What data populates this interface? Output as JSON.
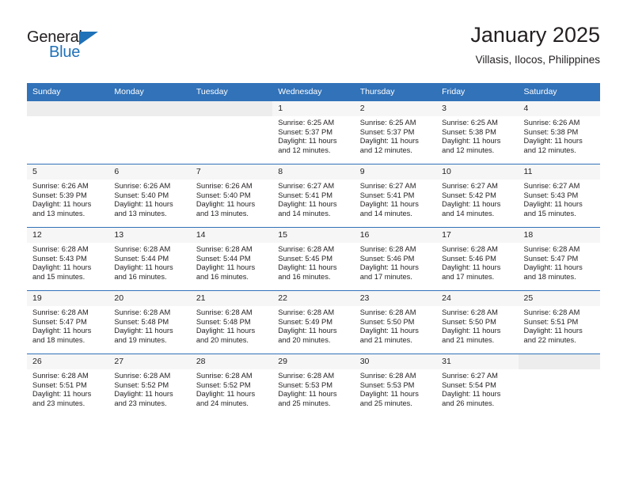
{
  "brand": {
    "name_dark": "General",
    "name_blue": "Blue",
    "accent_color": "#1f71b8"
  },
  "header": {
    "title": "January 2025",
    "subtitle": "Villasis, Ilocos, Philippines",
    "header_bg": "#3172b9"
  },
  "weekdays": [
    "Sunday",
    "Monday",
    "Tuesday",
    "Wednesday",
    "Thursday",
    "Friday",
    "Saturday"
  ],
  "labels": {
    "sunrise": "Sunrise:",
    "sunset": "Sunset:",
    "daylight": "Daylight:"
  },
  "weeks": [
    [
      {
        "day": "",
        "empty": true
      },
      {
        "day": "",
        "empty": true
      },
      {
        "day": "",
        "empty": true
      },
      {
        "day": "1",
        "sunrise": "Sunrise: 6:25 AM",
        "sunset": "Sunset: 5:37 PM",
        "daylight1": "Daylight: 11 hours",
        "daylight2": "and 12 minutes."
      },
      {
        "day": "2",
        "sunrise": "Sunrise: 6:25 AM",
        "sunset": "Sunset: 5:37 PM",
        "daylight1": "Daylight: 11 hours",
        "daylight2": "and 12 minutes."
      },
      {
        "day": "3",
        "sunrise": "Sunrise: 6:25 AM",
        "sunset": "Sunset: 5:38 PM",
        "daylight1": "Daylight: 11 hours",
        "daylight2": "and 12 minutes."
      },
      {
        "day": "4",
        "sunrise": "Sunrise: 6:26 AM",
        "sunset": "Sunset: 5:38 PM",
        "daylight1": "Daylight: 11 hours",
        "daylight2": "and 12 minutes."
      }
    ],
    [
      {
        "day": "5",
        "sunrise": "Sunrise: 6:26 AM",
        "sunset": "Sunset: 5:39 PM",
        "daylight1": "Daylight: 11 hours",
        "daylight2": "and 13 minutes."
      },
      {
        "day": "6",
        "sunrise": "Sunrise: 6:26 AM",
        "sunset": "Sunset: 5:40 PM",
        "daylight1": "Daylight: 11 hours",
        "daylight2": "and 13 minutes."
      },
      {
        "day": "7",
        "sunrise": "Sunrise: 6:26 AM",
        "sunset": "Sunset: 5:40 PM",
        "daylight1": "Daylight: 11 hours",
        "daylight2": "and 13 minutes."
      },
      {
        "day": "8",
        "sunrise": "Sunrise: 6:27 AM",
        "sunset": "Sunset: 5:41 PM",
        "daylight1": "Daylight: 11 hours",
        "daylight2": "and 14 minutes."
      },
      {
        "day": "9",
        "sunrise": "Sunrise: 6:27 AM",
        "sunset": "Sunset: 5:41 PM",
        "daylight1": "Daylight: 11 hours",
        "daylight2": "and 14 minutes."
      },
      {
        "day": "10",
        "sunrise": "Sunrise: 6:27 AM",
        "sunset": "Sunset: 5:42 PM",
        "daylight1": "Daylight: 11 hours",
        "daylight2": "and 14 minutes."
      },
      {
        "day": "11",
        "sunrise": "Sunrise: 6:27 AM",
        "sunset": "Sunset: 5:43 PM",
        "daylight1": "Daylight: 11 hours",
        "daylight2": "and 15 minutes."
      }
    ],
    [
      {
        "day": "12",
        "sunrise": "Sunrise: 6:28 AM",
        "sunset": "Sunset: 5:43 PM",
        "daylight1": "Daylight: 11 hours",
        "daylight2": "and 15 minutes."
      },
      {
        "day": "13",
        "sunrise": "Sunrise: 6:28 AM",
        "sunset": "Sunset: 5:44 PM",
        "daylight1": "Daylight: 11 hours",
        "daylight2": "and 16 minutes."
      },
      {
        "day": "14",
        "sunrise": "Sunrise: 6:28 AM",
        "sunset": "Sunset: 5:44 PM",
        "daylight1": "Daylight: 11 hours",
        "daylight2": "and 16 minutes."
      },
      {
        "day": "15",
        "sunrise": "Sunrise: 6:28 AM",
        "sunset": "Sunset: 5:45 PM",
        "daylight1": "Daylight: 11 hours",
        "daylight2": "and 16 minutes."
      },
      {
        "day": "16",
        "sunrise": "Sunrise: 6:28 AM",
        "sunset": "Sunset: 5:46 PM",
        "daylight1": "Daylight: 11 hours",
        "daylight2": "and 17 minutes."
      },
      {
        "day": "17",
        "sunrise": "Sunrise: 6:28 AM",
        "sunset": "Sunset: 5:46 PM",
        "daylight1": "Daylight: 11 hours",
        "daylight2": "and 17 minutes."
      },
      {
        "day": "18",
        "sunrise": "Sunrise: 6:28 AM",
        "sunset": "Sunset: 5:47 PM",
        "daylight1": "Daylight: 11 hours",
        "daylight2": "and 18 minutes."
      }
    ],
    [
      {
        "day": "19",
        "sunrise": "Sunrise: 6:28 AM",
        "sunset": "Sunset: 5:47 PM",
        "daylight1": "Daylight: 11 hours",
        "daylight2": "and 18 minutes."
      },
      {
        "day": "20",
        "sunrise": "Sunrise: 6:28 AM",
        "sunset": "Sunset: 5:48 PM",
        "daylight1": "Daylight: 11 hours",
        "daylight2": "and 19 minutes."
      },
      {
        "day": "21",
        "sunrise": "Sunrise: 6:28 AM",
        "sunset": "Sunset: 5:48 PM",
        "daylight1": "Daylight: 11 hours",
        "daylight2": "and 20 minutes."
      },
      {
        "day": "22",
        "sunrise": "Sunrise: 6:28 AM",
        "sunset": "Sunset: 5:49 PM",
        "daylight1": "Daylight: 11 hours",
        "daylight2": "and 20 minutes."
      },
      {
        "day": "23",
        "sunrise": "Sunrise: 6:28 AM",
        "sunset": "Sunset: 5:50 PM",
        "daylight1": "Daylight: 11 hours",
        "daylight2": "and 21 minutes."
      },
      {
        "day": "24",
        "sunrise": "Sunrise: 6:28 AM",
        "sunset": "Sunset: 5:50 PM",
        "daylight1": "Daylight: 11 hours",
        "daylight2": "and 21 minutes."
      },
      {
        "day": "25",
        "sunrise": "Sunrise: 6:28 AM",
        "sunset": "Sunset: 5:51 PM",
        "daylight1": "Daylight: 11 hours",
        "daylight2": "and 22 minutes."
      }
    ],
    [
      {
        "day": "26",
        "sunrise": "Sunrise: 6:28 AM",
        "sunset": "Sunset: 5:51 PM",
        "daylight1": "Daylight: 11 hours",
        "daylight2": "and 23 minutes."
      },
      {
        "day": "27",
        "sunrise": "Sunrise: 6:28 AM",
        "sunset": "Sunset: 5:52 PM",
        "daylight1": "Daylight: 11 hours",
        "daylight2": "and 23 minutes."
      },
      {
        "day": "28",
        "sunrise": "Sunrise: 6:28 AM",
        "sunset": "Sunset: 5:52 PM",
        "daylight1": "Daylight: 11 hours",
        "daylight2": "and 24 minutes."
      },
      {
        "day": "29",
        "sunrise": "Sunrise: 6:28 AM",
        "sunset": "Sunset: 5:53 PM",
        "daylight1": "Daylight: 11 hours",
        "daylight2": "and 25 minutes."
      },
      {
        "day": "30",
        "sunrise": "Sunrise: 6:28 AM",
        "sunset": "Sunset: 5:53 PM",
        "daylight1": "Daylight: 11 hours",
        "daylight2": "and 25 minutes."
      },
      {
        "day": "31",
        "sunrise": "Sunrise: 6:27 AM",
        "sunset": "Sunset: 5:54 PM",
        "daylight1": "Daylight: 11 hours",
        "daylight2": "and 26 minutes."
      },
      {
        "day": "",
        "empty": true
      }
    ]
  ]
}
